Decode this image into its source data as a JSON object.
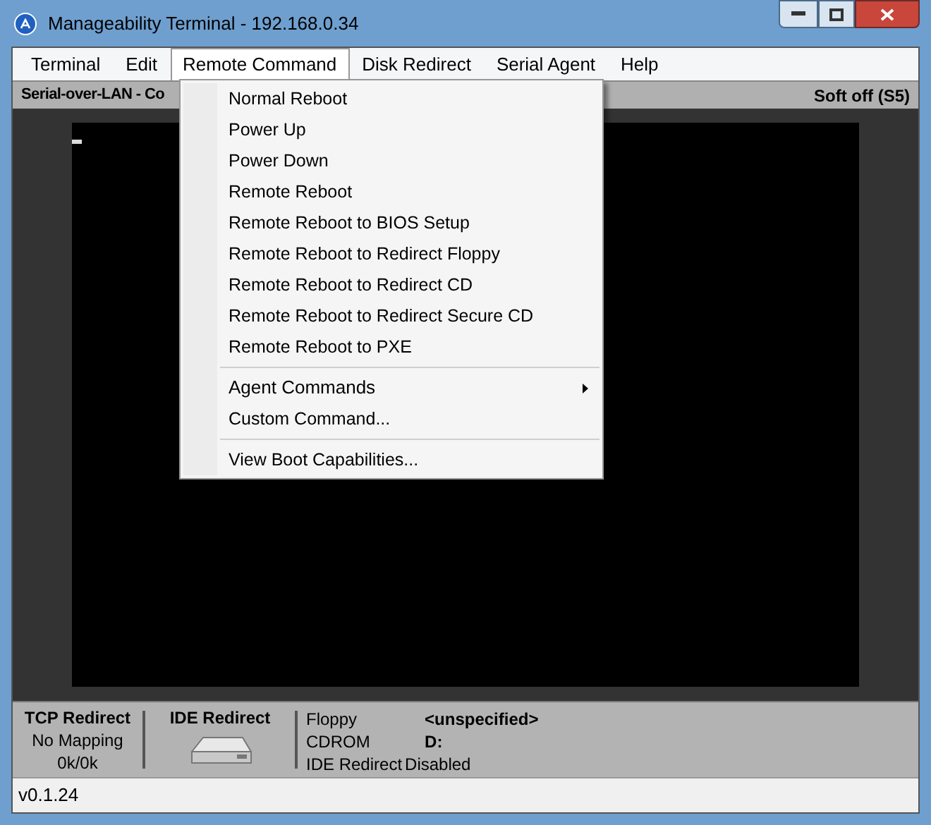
{
  "window": {
    "title": "Manageability Terminal - 192.168.0.34"
  },
  "menu": [
    {
      "label": "Terminal",
      "selected": false
    },
    {
      "label": "Edit",
      "selected": false
    },
    {
      "label": "Remote Command",
      "selected": true
    },
    {
      "label": "Disk Redirect",
      "selected": false
    },
    {
      "label": "Serial Agent",
      "selected": false
    },
    {
      "label": "Help",
      "selected": false
    }
  ],
  "dropdown": [
    {
      "kind": "item",
      "label": "Normal Reboot"
    },
    {
      "kind": "item",
      "label": "Power Up"
    },
    {
      "kind": "item",
      "label": "Power Down"
    },
    {
      "kind": "item",
      "label": "Remote Reboot"
    },
    {
      "kind": "item",
      "label": "Remote Reboot to BIOS Setup"
    },
    {
      "kind": "item",
      "label": "Remote Reboot to Redirect Floppy"
    },
    {
      "kind": "item",
      "label": "Remote Reboot to Redirect CD"
    },
    {
      "kind": "item",
      "label": "Remote Reboot to Redirect Secure CD"
    },
    {
      "kind": "item",
      "label": "Remote Reboot to PXE"
    },
    {
      "kind": "separator"
    },
    {
      "kind": "submenu",
      "label": "Agent Commands"
    },
    {
      "kind": "item",
      "label": "Custom Command..."
    },
    {
      "kind": "separator"
    },
    {
      "kind": "item",
      "label": "View Boot Capabilities..."
    }
  ],
  "status_strip": {
    "left": "Serial-over-LAN - Co",
    "right": "Soft off (S5)"
  },
  "tcp_redirect": {
    "title": "TCP Redirect",
    "mapping": "No Mapping",
    "traffic": "0k/0k"
  },
  "ide_redirect": {
    "title": "IDE Redirect",
    "rows": [
      {
        "label": "Floppy",
        "value": "<unspecified>",
        "bold": true
      },
      {
        "label": "CDROM",
        "value": "D:",
        "bold": true
      },
      {
        "label": "IDE Redirect",
        "value": "Disabled",
        "bold": false
      }
    ]
  },
  "status_bar": {
    "version": "v0.1.24"
  }
}
